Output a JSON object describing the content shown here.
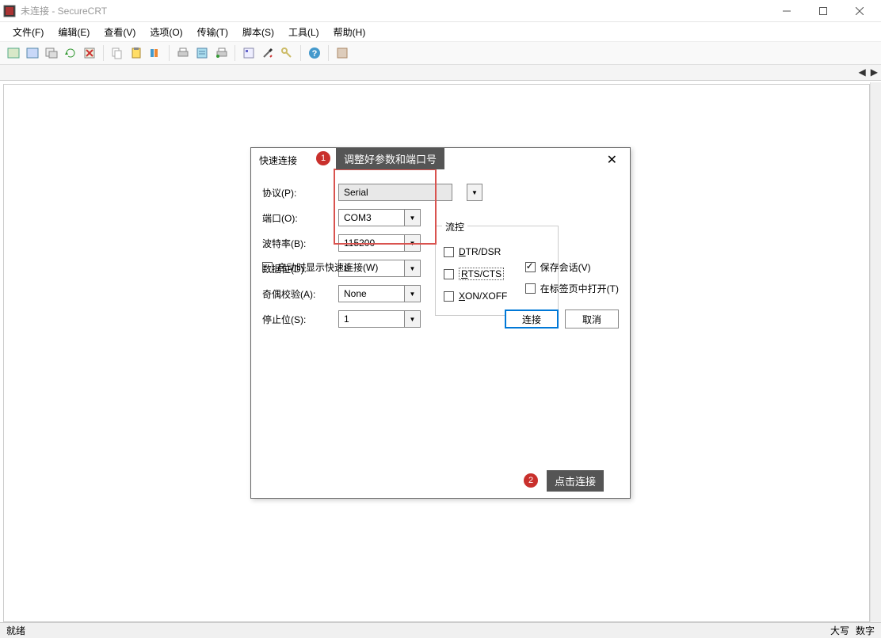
{
  "window": {
    "title": "未连接 - SecureCRT"
  },
  "menu": {
    "file": "文件(F)",
    "edit": "编辑(E)",
    "view": "查看(V)",
    "options": "选项(O)",
    "transfer": "传输(T)",
    "script": "脚本(S)",
    "tools": "工具(L)",
    "help": "帮助(H)"
  },
  "dialog": {
    "title": "快速连接",
    "protocol_label": "协议(P):",
    "protocol_value": "Serial",
    "port_label": "端口(O):",
    "port_value": "COM3",
    "baud_label": "波特率(B):",
    "baud_value": "115200",
    "databits_label": "数据位(D):",
    "databits_value": "8",
    "parity_label": "奇偶校验(A):",
    "parity_value": "None",
    "stopbits_label": "停止位(S):",
    "stopbits_value": "1",
    "flowctrl_legend": "流控",
    "flow_dtr": "DTR/DSR",
    "flow_rts": "RTS/CTS",
    "flow_xon": "XON/XOFF",
    "show_on_start": "启动时显示快速连接(W)",
    "save_session": "保存会话(V)",
    "open_in_tab": "在标签页中打开(T)",
    "connect_btn": "连接",
    "cancel_btn": "取消"
  },
  "annotations": {
    "badge1": "1",
    "tip1": "调整好参数和端口号",
    "badge2": "2",
    "tip2": "点击连接"
  },
  "statusbar": {
    "ready": "就绪",
    "caps": "大写",
    "num": "数字"
  },
  "tabstrip": {
    "left_arrow": "◀",
    "right_arrow": "▶"
  }
}
